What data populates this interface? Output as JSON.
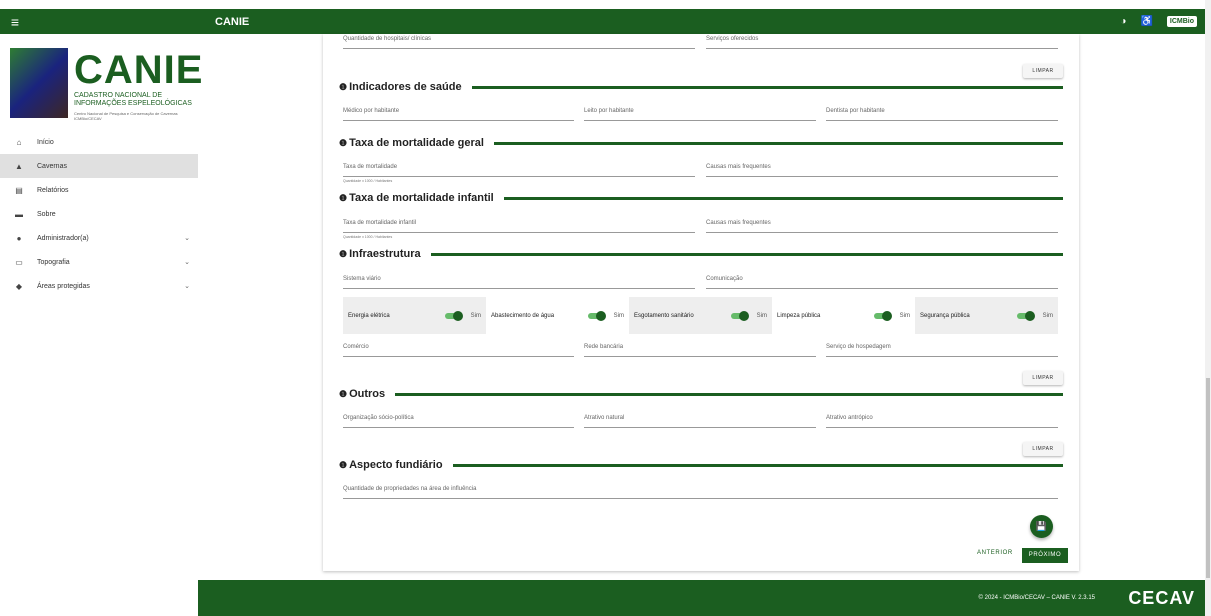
{
  "topbar": {
    "menu_icon": "menu-icon",
    "title": "CANIE",
    "contrast_icon": "contrast-icon",
    "accessibility_icon": "accessibility-icon",
    "logo": "ICMBio"
  },
  "brand": {
    "name": "CANIE",
    "subtitle": "CADASTRO NACIONAL DE INFORMAÇÕES ESPELEOLÓGICAS",
    "sub2": "Centro Nacional de Pesquisa e Conservação de Cavernas ICMBio/CECAV"
  },
  "nav": [
    {
      "label": "Início",
      "icon": "⌂"
    },
    {
      "label": "Cavernas",
      "icon": "▲"
    },
    {
      "label": "Relatórios",
      "icon": "▤"
    },
    {
      "label": "Sobre",
      "icon": "▬"
    },
    {
      "label": "Administrador(a)",
      "icon": "●"
    },
    {
      "label": "Topografia",
      "icon": "▭"
    },
    {
      "label": "Áreas protegidas",
      "icon": "◆"
    }
  ],
  "fields": {
    "hospitais": "Quantidade de hospitais/ clínicas",
    "servicos": "Serviços oferecidos",
    "medico": "Médico por habitante",
    "leito": "Leito por habitante",
    "dentista": "Dentista por habitante",
    "taxa_mort": "Taxa de mortalidade",
    "causas1": "Causas mais frequentes",
    "hint1": "Quantidade x 1000 / Habitantes",
    "taxa_inf": "Taxa de mortalidade infantil",
    "causas2": "Causas mais frequentes",
    "hint2": "Quantidade x 1000 / Habitantes",
    "sistema": "Sistema viário",
    "comunicacao": "Comunicação",
    "comercio": "Comércio",
    "bancaria": "Rede bancária",
    "hospedagem": "Serviço de hospedagem",
    "organizacao": "Organização sócio-política",
    "atrativo_nat": "Atrativo natural",
    "atrativo_ant": "Atrativo antrópico",
    "propriedades": "Quantidade de propriedades na área de influência"
  },
  "sections": {
    "saude": "Indicadores de saúde",
    "mort": "Taxa de mortalidade geral",
    "infantil": "Taxa de mortalidade infantil",
    "infra": "Infraestrutura",
    "outros": "Outros",
    "fundiario": "Aspecto fundiário"
  },
  "switches": [
    {
      "label": "Energia elétrica",
      "state": "Sim"
    },
    {
      "label": "Abastecimento de água",
      "state": "Sim"
    },
    {
      "label": "Esgotamento sanitário",
      "state": "Sim"
    },
    {
      "label": "Limpeza pública",
      "state": "Sim"
    },
    {
      "label": "Segurança pública",
      "state": "Sim"
    }
  ],
  "buttons": {
    "limpar": "LIMPAR",
    "anterior": "ANTERIOR",
    "proximo": "PRÓXIMO",
    "save_icon": "save-icon"
  },
  "footer": {
    "copy": "© 2024 - ICMBio/CECAV – CANIE V. 2.3.15",
    "cecav": "CECAV"
  },
  "colors": {
    "primary": "#1b5e20"
  }
}
